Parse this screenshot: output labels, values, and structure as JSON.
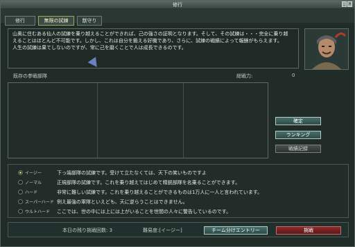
{
  "window": {
    "title": "修行",
    "close": "×",
    "minimize": "_"
  },
  "tabs": [
    {
      "label": "修行"
    },
    {
      "label": "無限の試練"
    },
    {
      "label": "獣守り"
    }
  ],
  "description": {
    "lines": [
      "山奥に住むある仙人の試練を乗り越えることができれば、己の強さの証明となります。そして、その試練は・・・完全に乗り越",
      "えることはほとんど不可能です。しかし、これは自分を鍛える好機であり、さらに、試練の戦績によって報酬がもらえます。",
      "人生の試練は果てしないのですが、常に己を磨くことで人は成長できるのです。"
    ]
  },
  "list": {
    "current_units_label": "既存の参戦部隊",
    "total_power_label": "総戦力:",
    "total_power_value": "0"
  },
  "actions": {
    "confirm": "確定",
    "ranking": "ランキング",
    "history": "戦績記録"
  },
  "difficulty": {
    "options": [
      {
        "name": "イージー",
        "desc": "下っ端部隊の試練です。受けて立たなくては、天下の笑いものですよ",
        "selected": true
      },
      {
        "name": "ノーマル",
        "desc": "正規部隊の試練です。これを乗り越えてはじめて精鋭部隊を名乗ることができます。",
        "selected": false
      },
      {
        "name": "ハード",
        "desc": "非常に難しい試練です。これを乗り越えることができるものは1万人に一人と言われています。",
        "selected": false
      },
      {
        "name": "スーパーハード",
        "desc": "例え最強の軍隊といえども、天に逆らうことはできません。",
        "selected": false
      },
      {
        "name": "ウルトハード",
        "desc": "ここでは、世の中には上には上がいることを世間の人々に警告しているのです。",
        "selected": false
      }
    ]
  },
  "footer": {
    "remaining_label": "本日の残り挑戦回数: 3",
    "difficulty_label": "難易度:[イージー]",
    "team_entry": "チーム分けエントリー",
    "challenge": "挑戦"
  }
}
